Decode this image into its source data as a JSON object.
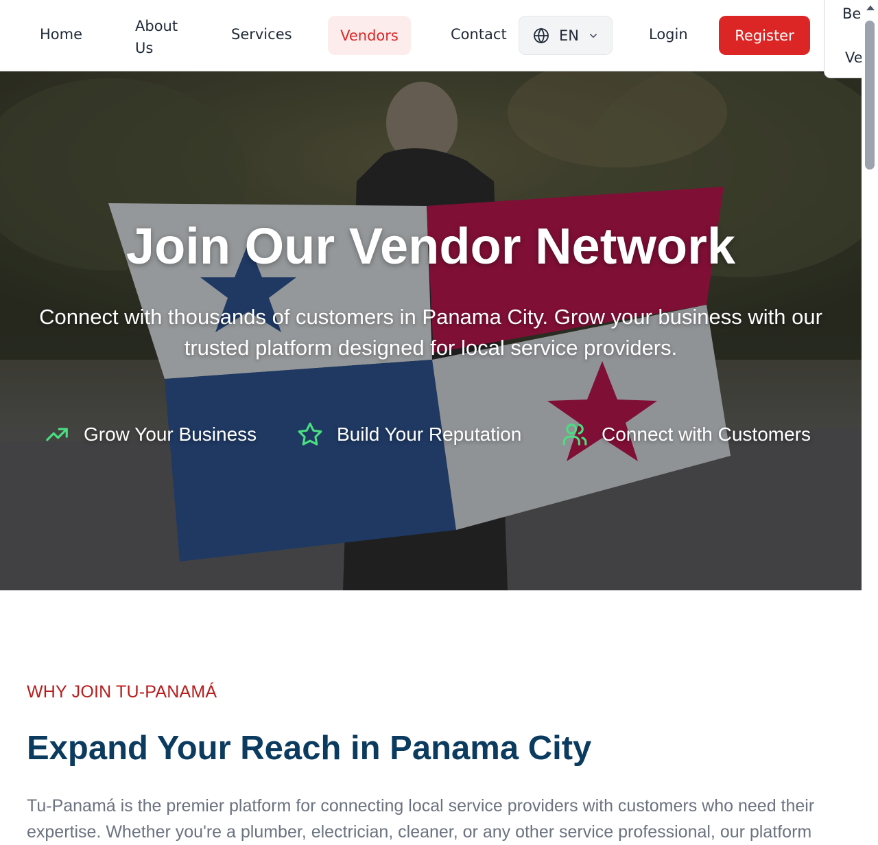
{
  "nav": {
    "home": "Home",
    "about": "About Us",
    "services": "Services",
    "vendors": "Vendors",
    "contact": "Contact",
    "language": "EN",
    "login": "Login",
    "register": "Register"
  },
  "side_menu": {
    "line1": "Bec",
    "line2": "Ve"
  },
  "hero": {
    "title": "Join Our Vendor Network",
    "subtitle": "Connect with thousands of customers in Panama City. Grow your business with our trusted platform designed for local service providers.",
    "features": [
      {
        "icon": "trending-up-icon",
        "label": "Grow Your Business"
      },
      {
        "icon": "star-icon",
        "label": "Build Your Reputation"
      },
      {
        "icon": "users-icon",
        "label": "Connect with Customers"
      }
    ]
  },
  "section": {
    "kicker": "WHY JOIN TU-PANAMÁ",
    "title": "Expand Your Reach in Panama City",
    "body": "Tu-Panamá is the premier platform for connecting local service providers with customers who need their expertise. Whether you're a plumber, electrician, cleaner, or any other service professional, our platform"
  },
  "colors": {
    "accent": "#dc2626",
    "vendors_bg": "#fdecec",
    "heading": "#0b3b5f",
    "feature_icon": "#4ade80"
  }
}
